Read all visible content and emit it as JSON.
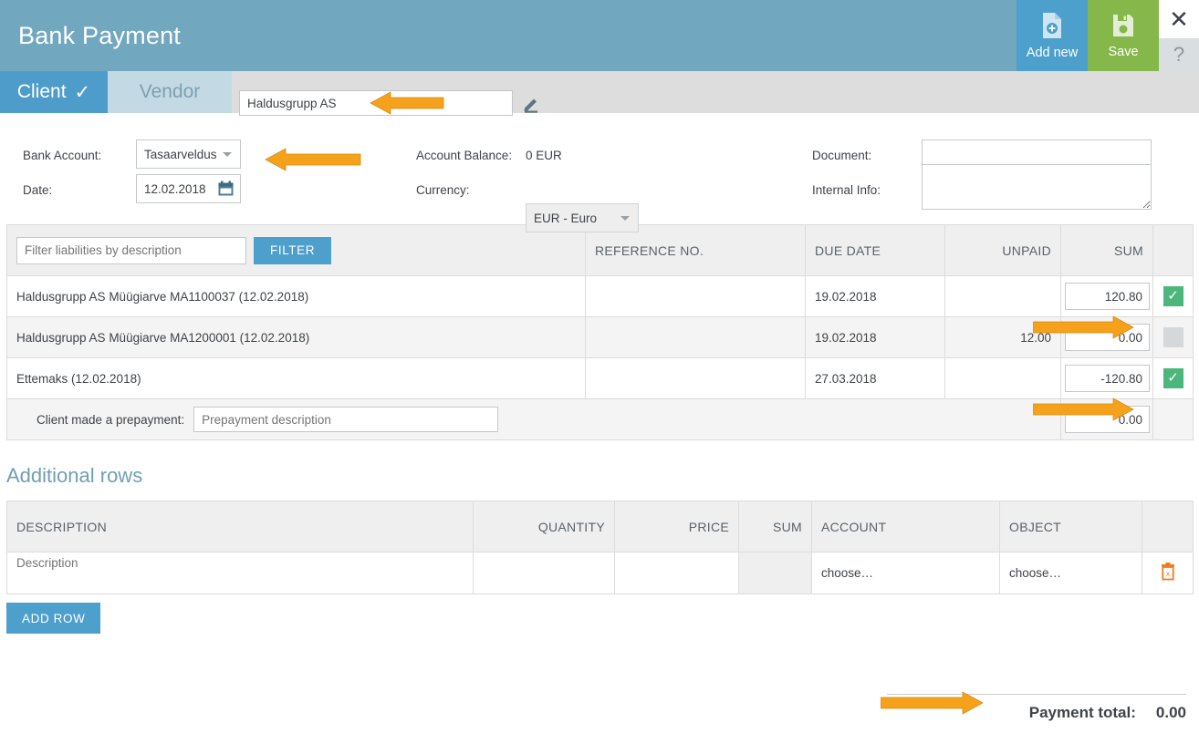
{
  "header": {
    "title": "Bank Payment",
    "add_new_label": "Add new",
    "save_label": "Save",
    "close_glyph": "✕",
    "help_glyph": "?"
  },
  "party_tabs": {
    "client_label": "Client",
    "client_check": "✓",
    "vendor_label": "Vendor",
    "client_name_value": "Haldusgrupp AS"
  },
  "form": {
    "bank_account_label": "Bank Account:",
    "bank_account_value": "Tasaarveldus",
    "date_label": "Date:",
    "date_value": "12.02.2018",
    "account_balance_label": "Account Balance:",
    "account_balance_value": "0 EUR",
    "currency_label": "Currency:",
    "currency_value": "EUR - Euro",
    "document_label": "Document:",
    "document_value": "",
    "internal_info_label": "Internal Info:",
    "internal_info_value": ""
  },
  "liabilities": {
    "filter_placeholder": "Filter liabilities by description",
    "filter_button": "FILTER",
    "columns": [
      "",
      "REFERENCE NO.",
      "DUE DATE",
      "UNPAID",
      "SUM",
      ""
    ],
    "rows": [
      {
        "description": "Haldusgrupp AS Müügiarve MA1100037 (12.02.2018)",
        "reference_no": "",
        "due_date": "19.02.2018",
        "unpaid": "",
        "sum": "120.80",
        "checked": true
      },
      {
        "description": "Haldusgrupp AS Müügiarve MA1200001 (12.02.2018)",
        "reference_no": "",
        "due_date": "19.02.2018",
        "unpaid": "12.00",
        "sum": "0.00",
        "checked": false
      },
      {
        "description": "Ettemaks (12.02.2018)",
        "reference_no": "",
        "due_date": "27.03.2018",
        "unpaid": "",
        "sum": "-120.80",
        "checked": true
      }
    ],
    "prepayment_label": "Client made a prepayment:",
    "prepayment_placeholder": "Prepayment description",
    "prepayment_sum": "0.00"
  },
  "additional_rows": {
    "section_title": "Additional rows",
    "columns": [
      "DESCRIPTION",
      "QUANTITY",
      "PRICE",
      "SUM",
      "ACCOUNT",
      "OBJECT",
      ""
    ],
    "rows": [
      {
        "description_placeholder": "Description",
        "quantity": "",
        "price": "",
        "sum": "",
        "account": "choose…",
        "object": "choose…"
      }
    ],
    "add_row_button": "ADD ROW"
  },
  "footer": {
    "payment_total_label": "Payment total:",
    "payment_total_value": "0.00"
  },
  "colors": {
    "header_bar": "#71a8c0",
    "accent_blue": "#4d9fcc",
    "client_tab_blue": "#4d9cca",
    "vendor_tab_blue": "#c3dae5",
    "save_green": "#85b74a",
    "check_green": "#4cb77c",
    "annotation_orange": "#f5a11b",
    "section_title_teal": "#6f9fb4"
  }
}
